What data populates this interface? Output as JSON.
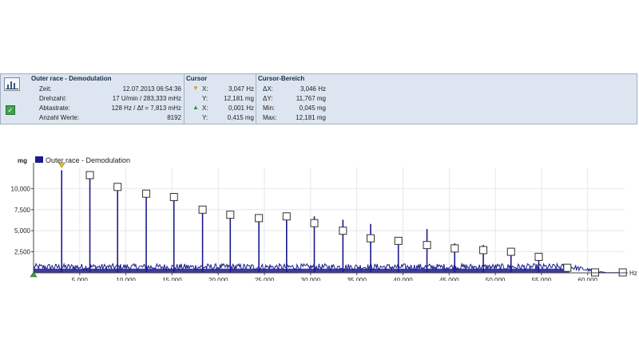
{
  "header": {
    "title": "Outer race - Demodulation",
    "info": [
      {
        "label": "Zeit:",
        "value": "12.07.2013 06:54:36"
      },
      {
        "label": "Drehzahl:",
        "value": "17 U/min / 283,333 mHz"
      },
      {
        "label": "Abtastrate:",
        "value": "128 Hz / Δf = 7,813 mHz"
      },
      {
        "label": "Anzahl Werte:",
        "value": "8192"
      }
    ],
    "cursor": {
      "title": "Cursor",
      "rows": [
        {
          "label": "X:",
          "value": "3,047 Hz"
        },
        {
          "label": "Y:",
          "value": "12,181 mg"
        },
        {
          "label": "X:",
          "value": "0,001 Hz"
        },
        {
          "label": "Y:",
          "value": "0,415 mg"
        }
      ],
      "marker_colors": [
        "#e8c020",
        "#3aa13a"
      ]
    },
    "range": {
      "title": "Cursor-Bereich",
      "rows": [
        {
          "label": "ΔX:",
          "value": "3,046 Hz"
        },
        {
          "label": "ΔY:",
          "value": "11,767 mg"
        },
        {
          "label": "Min:",
          "value": "0,045 mg"
        },
        {
          "label": "Max:",
          "value": "12,181 mg"
        }
      ]
    }
  },
  "chart_data": {
    "type": "line",
    "title": "",
    "xlabel": "",
    "ylabel": "mg",
    "x_unit_label": "Hz",
    "legend": [
      "Outer race - Demodulation"
    ],
    "xlim": [
      0,
      64000
    ],
    "ylim": [
      0,
      12500
    ],
    "x_ticks": [
      {
        "value": 5000,
        "label": "5,000"
      },
      {
        "value": 10000,
        "label": "10,000"
      },
      {
        "value": 15000,
        "label": "15,000"
      },
      {
        "value": 20000,
        "label": "20,000"
      },
      {
        "value": 25000,
        "label": "25,000"
      },
      {
        "value": 30000,
        "label": "30,000"
      },
      {
        "value": 35000,
        "label": "35,000"
      },
      {
        "value": 40000,
        "label": "40,000"
      },
      {
        "value": 45000,
        "label": "45,000"
      },
      {
        "value": 50000,
        "label": "50,000"
      },
      {
        "value": 55000,
        "label": "55,000"
      },
      {
        "value": 60000,
        "label": "60,000"
      }
    ],
    "y_ticks": [
      {
        "value": 2500,
        "label": "2,500"
      },
      {
        "value": 5000,
        "label": "5,000"
      },
      {
        "value": 7500,
        "label": "7,500"
      },
      {
        "value": 10000,
        "label": "10,000"
      }
    ],
    "noise_level": 700,
    "series_color": "#1a1a8c",
    "peaks": [
      {
        "x": 3047,
        "y": 12181
      },
      {
        "x": 6100,
        "y": 11600
      },
      {
        "x": 9100,
        "y": 10200
      },
      {
        "x": 12200,
        "y": 9400
      },
      {
        "x": 15200,
        "y": 9000
      },
      {
        "x": 18300,
        "y": 7500
      },
      {
        "x": 21300,
        "y": 6600
      },
      {
        "x": 24400,
        "y": 6500
      },
      {
        "x": 27400,
        "y": 6700
      },
      {
        "x": 30400,
        "y": 6700
      },
      {
        "x": 33500,
        "y": 6300
      },
      {
        "x": 36500,
        "y": 5800
      },
      {
        "x": 39500,
        "y": 3800
      },
      {
        "x": 42600,
        "y": 5200
      },
      {
        "x": 45600,
        "y": 3500
      },
      {
        "x": 48700,
        "y": 3300
      },
      {
        "x": 51700,
        "y": 2500
      },
      {
        "x": 54700,
        "y": 1900
      }
    ],
    "harmonic_markers": [
      {
        "x": 6100,
        "y": 11600
      },
      {
        "x": 9100,
        "y": 10200
      },
      {
        "x": 12200,
        "y": 9400
      },
      {
        "x": 15200,
        "y": 9000
      },
      {
        "x": 18300,
        "y": 7500
      },
      {
        "x": 21300,
        "y": 6900
      },
      {
        "x": 24400,
        "y": 6500
      },
      {
        "x": 27400,
        "y": 6700
      },
      {
        "x": 30400,
        "y": 5900
      },
      {
        "x": 33500,
        "y": 5000
      },
      {
        "x": 36500,
        "y": 4100
      },
      {
        "x": 39500,
        "y": 3800
      },
      {
        "x": 42600,
        "y": 3300
      },
      {
        "x": 45600,
        "y": 2900
      },
      {
        "x": 48700,
        "y": 2700
      },
      {
        "x": 51700,
        "y": 2500
      },
      {
        "x": 54700,
        "y": 1900
      },
      {
        "x": 57800,
        "y": 600
      },
      {
        "x": 60800,
        "y": 50
      },
      {
        "x": 63800,
        "y": 50
      }
    ],
    "cursor_x": 3047,
    "cursor2_x": 0
  }
}
